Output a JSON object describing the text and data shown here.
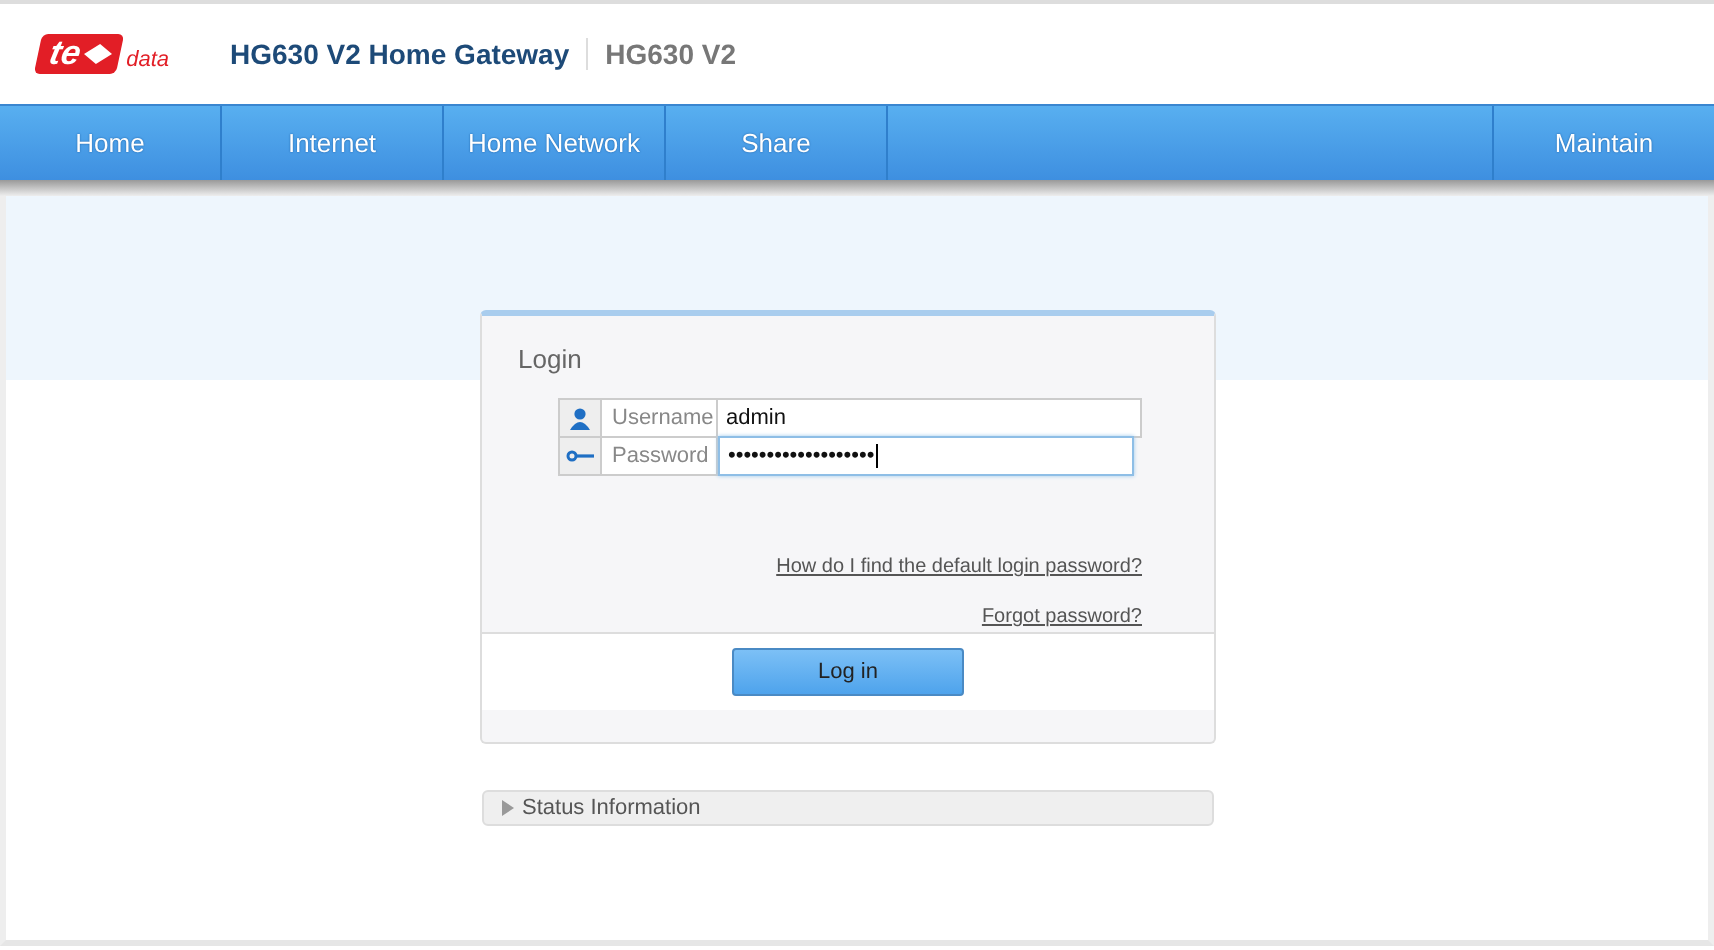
{
  "header": {
    "logo": {
      "main": "te",
      "sub": "data"
    },
    "title": "HG630 V2 Home Gateway",
    "model": "HG630 V2"
  },
  "nav_left": [
    {
      "label": "Home"
    },
    {
      "label": "Internet"
    },
    {
      "label": "Home Network"
    },
    {
      "label": "Share"
    }
  ],
  "nav_right": [
    {
      "label": "Maintain"
    }
  ],
  "login": {
    "title": "Login",
    "fields": [
      {
        "kind": "user",
        "label": "Username",
        "value": "admin",
        "focused": false
      },
      {
        "kind": "key",
        "label": "Password",
        "value": "•••••••••••••••••••",
        "focused": true
      }
    ],
    "links": [
      "How do I find the default login password?",
      "Forgot password?"
    ],
    "button": "Log in"
  },
  "status": {
    "label": "Status Information",
    "expanded": false
  }
}
